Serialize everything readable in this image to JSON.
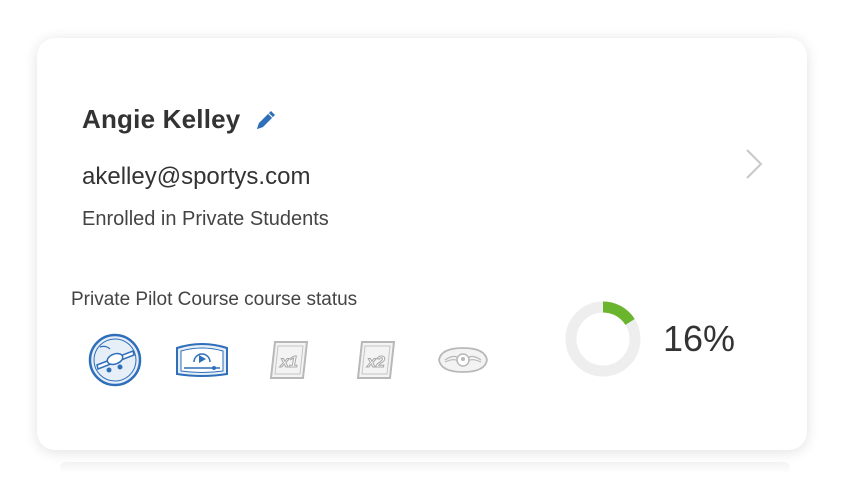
{
  "student": {
    "name": "Angie Kelley",
    "email": "akelley@sportys.com",
    "enrollment": "Enrolled in Private Students"
  },
  "course": {
    "status_label": "Private Pilot Course course status",
    "progress_percent": 16,
    "progress_text": "16%",
    "badges": [
      {
        "icon": "airplane-badge-icon",
        "state": "earned"
      },
      {
        "icon": "video-lesson-badge-icon",
        "state": "earned"
      },
      {
        "icon": "x1-badge-icon",
        "state": "locked"
      },
      {
        "icon": "x2-badge-icon",
        "state": "locked"
      },
      {
        "icon": "wings-badge-icon",
        "state": "locked"
      }
    ]
  },
  "colors": {
    "accent_blue": "#2f6fba",
    "progress_green": "#6ab42e",
    "ring_track": "#eeeeee",
    "locked_gray": "#b8b8b8"
  }
}
